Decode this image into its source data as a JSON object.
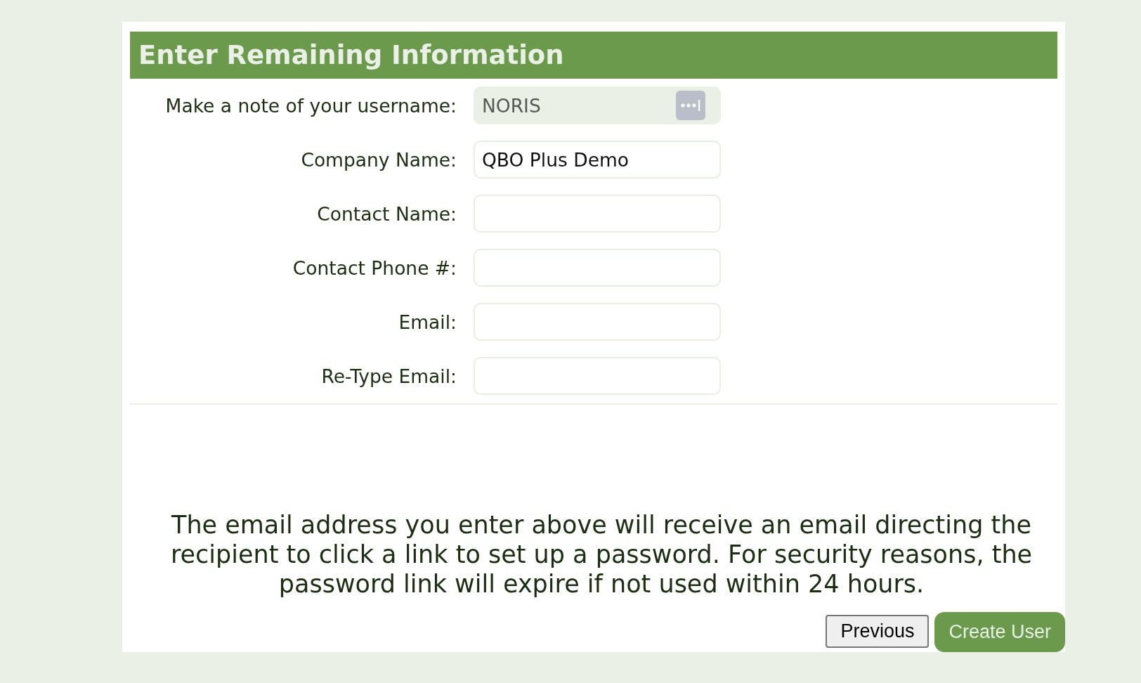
{
  "title": "Enter Remaining Information",
  "form": {
    "rows": [
      {
        "label": "Make a note of your username:",
        "value": "NORIS",
        "readonly": true,
        "autofill": true
      },
      {
        "label": "Company Name:",
        "value": "QBO Plus Demo",
        "readonly": false,
        "autofill": false
      },
      {
        "label": "Contact Name:",
        "readonly": false,
        "autofill": false
      },
      {
        "label": "Contact Phone #:",
        "readonly": false,
        "autofill": false
      },
      {
        "label": "Email:",
        "readonly": false,
        "autofill": false
      },
      {
        "label": "Re-Type Email:",
        "readonly": false,
        "autofill": false
      }
    ]
  },
  "notice": "The email address you enter above will receive an email directing the recipient to click a link to set up a password. For security reasons, the password link will expire if not used within 24 hours.",
  "buttons": [
    {
      "label": "Previous",
      "kind": "secondary"
    },
    {
      "label": "Create User",
      "kind": "primary"
    }
  ]
}
